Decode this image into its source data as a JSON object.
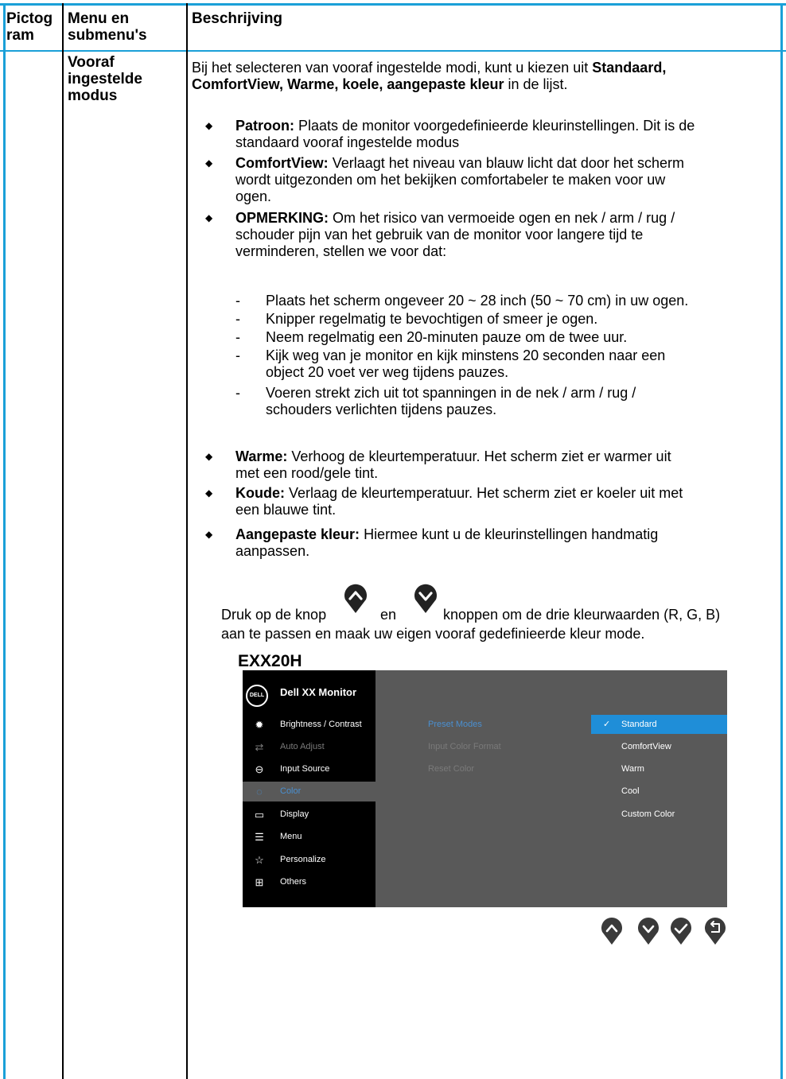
{
  "table": {
    "headers": {
      "col1": "Pictog ram",
      "col1_line1": "Pictog",
      "col1_line2": "ram",
      "col2_line1": "Menu en",
      "col2_line2": "submenu's",
      "col3": "Beschrijving"
    },
    "menu_title_lines": [
      "Vooraf",
      "ingestelde",
      "modus"
    ],
    "intro_lines": [
      [
        "Bij het selecteren van vooraf ingestelde modi, kunt u kiezen uit ",
        "Standaard,"
      ],
      [
        "ComfortView, Warme, koele, aangepaste kleur",
        " in de lijst."
      ]
    ],
    "bullets": [
      {
        "term": "Patroon:",
        "lines": [
          " Plaats de monitor voorgedefinieerde kleurinstellingen. Dit is de",
          "standaard vooraf ingestelde modus"
        ]
      },
      {
        "term": "ComfortView:",
        "lines": [
          " Verlaagt het niveau van blauw licht dat door het scherm",
          "wordt uitgezonden om het bekijken comfortabeler te maken voor uw",
          "ogen."
        ]
      },
      {
        "term": "OPMERKING:",
        "lines": [
          " Om het risico van vermoeide ogen en nek / arm / rug /",
          "schouder pijn van het gebruik van de monitor voor langere tijd te",
          "verminderen, stellen we voor dat:"
        ]
      }
    ],
    "dashes": [
      [
        "Plaats het scherm ongeveer 20 ~ 28 inch (50 ~ 70 cm) in uw ogen."
      ],
      [
        "Knipper regelmatig te bevochtigen of smeer je ogen."
      ],
      [
        "Neem regelmatig een 20-minuten pauze om de twee uur."
      ],
      [
        "Kijk weg van je monitor en kijk minstens 20 seconden naar een",
        "object 20 voet ver weg tijdens pauzes."
      ],
      [
        "Voeren strekt zich uit tot spanningen in de nek / arm / rug /",
        "schouders verlichten tijdens pauzes."
      ]
    ],
    "bullets2": [
      {
        "term": "Warme:",
        "lines": [
          " Verhoog de kleurtemperatuur. Het scherm ziet er warmer uit",
          "met een rood/gele tint."
        ]
      },
      {
        "term": "Koude:",
        "lines": [
          " Verlaag de kleurtemperatuur. Het scherm ziet er koeler uit met",
          "een blauwe tint."
        ]
      },
      {
        "term": "Aangepaste kleur:",
        "lines": [
          " Hiermee kunt u de kleurinstellingen handmatig",
          "aanpassen."
        ]
      }
    ],
    "press": {
      "a": "Druk op de knop",
      "b": "en",
      "c": "knoppen om de drie kleurwaarden (R, G, B)",
      "line2": "aan te passen en maak uw eigen vooraf gedefinieerde kleur mode."
    },
    "model": "EXX20H"
  },
  "osd": {
    "brand": "DELL",
    "title": "Dell XX Monitor",
    "menu": [
      {
        "label": "Brightness / Contrast",
        "icon": "sun-icon",
        "state": "normal"
      },
      {
        "label": "Auto Adjust",
        "icon": "arrows-icon",
        "state": "dim"
      },
      {
        "label": "Input Source",
        "icon": "input-icon",
        "state": "normal"
      },
      {
        "label": "Color",
        "icon": "color-drop-icon",
        "state": "selected"
      },
      {
        "label": "Display",
        "icon": "monitor-icon",
        "state": "normal"
      },
      {
        "label": "Menu",
        "icon": "menu-list-icon",
        "state": "normal"
      },
      {
        "label": "Personalize",
        "icon": "star-icon",
        "state": "normal"
      },
      {
        "label": "Others",
        "icon": "others-icon",
        "state": "normal"
      }
    ],
    "submenu": [
      "Preset Modes",
      "Input Color Format",
      "Reset Color"
    ],
    "options": [
      "Standard",
      "ComfortView",
      "Warm",
      "Cool",
      "Custom Color"
    ],
    "selected_option": "Standard",
    "colors": {
      "panel": "#595959",
      "sidebar": "#000000",
      "highlight": "#1f8ed8",
      "accent_text": "#4a8fd0"
    }
  },
  "buttons": [
    "up-icon",
    "down-icon",
    "check-icon",
    "back-icon"
  ]
}
